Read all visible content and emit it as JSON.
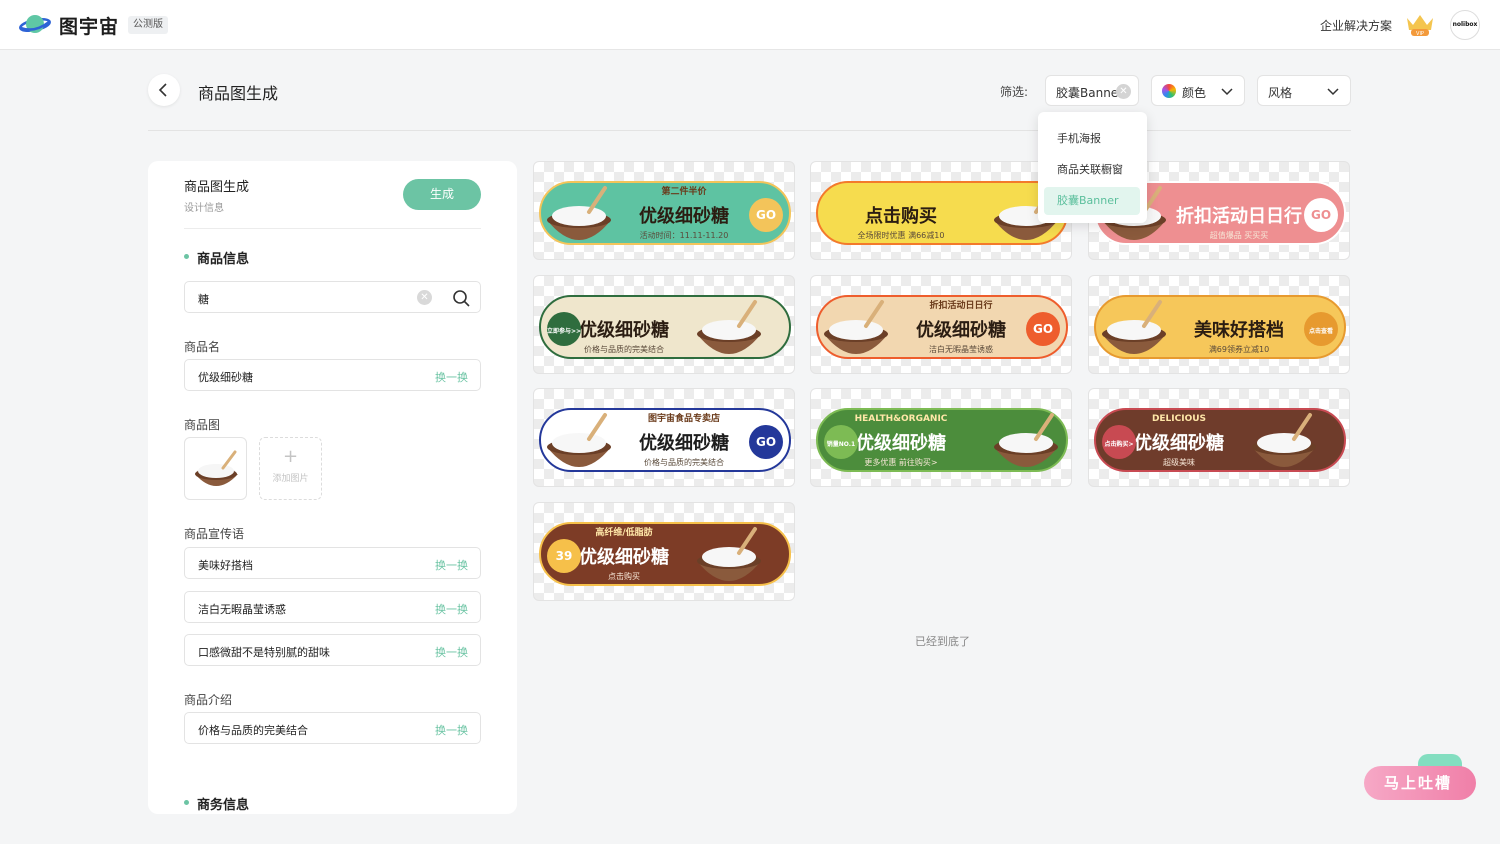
{
  "header": {
    "logo_text": "图宇宙",
    "beta_badge": "公测版",
    "enterprise_link": "企业解决方案",
    "vip_badge": "VIP",
    "avatar_text": "nolibox"
  },
  "page": {
    "title": "商品图生成"
  },
  "filters": {
    "label": "筛选:",
    "type_value": "胶囊Banner",
    "color_label": "颜色",
    "style_label": "风格",
    "dropdown_options": [
      "手机海报",
      "商品关联橱窗",
      "胶囊Banner"
    ],
    "dropdown_selected": "胶囊Banner"
  },
  "panel": {
    "title": "商品图生成",
    "subtitle": "设计信息",
    "generate_button": "生成",
    "product_info_title": "商品信息",
    "search_value": "糖",
    "product_name_label": "商品名",
    "product_name_value": "优级细砂糖",
    "product_image_label": "商品图",
    "add_image_label": "添加图片",
    "slogan_label": "商品宣传语",
    "slogans": [
      "美味好搭档",
      "洁白无暇晶莹诱惑",
      "口感微甜不是特别腻的甜味"
    ],
    "intro_label": "商品介绍",
    "intro_value": "价格与品质的完美结合",
    "swap_label": "换一换",
    "business_info_title": "商务信息"
  },
  "banners": [
    {
      "top": "第二件半价",
      "title": "优级细砂糖",
      "sub": "活动时间：11.11-11.20",
      "cta": "GO",
      "bg": "#5ec3a2",
      "accent": "#f3c45a"
    },
    {
      "top": "",
      "title": "点击购买",
      "sub": "全场限时优惠 满66减10",
      "cta": "",
      "bg": "#f6dc4e",
      "accent": "#f37a2b"
    },
    {
      "top": "",
      "title": "折扣活动日日行",
      "sub": "超值爆品 买买买",
      "cta": "GO",
      "bg": "#ee8f91",
      "accent": "#ffffff"
    },
    {
      "top": "",
      "title": "优级细砂糖",
      "sub": "价格与品质的完美结合",
      "cta": "立即参与>>",
      "bg": "#efe6cc",
      "accent": "#2f6d3e"
    },
    {
      "top": "折扣活动日日行",
      "title": "优级细砂糖",
      "sub": "洁白无暇晶莹诱惑",
      "cta": "GO",
      "bg": "#f2d7b0",
      "accent": "#ee5d2d"
    },
    {
      "top": "",
      "title": "美味好搭档",
      "sub": "满69领券立减10",
      "cta": "点击查看",
      "bg": "#f6c75a",
      "accent": "#e79a2f"
    },
    {
      "top": "图宇宙食品专卖店",
      "title": "优级细砂糖",
      "sub": "价格与品质的完美结合",
      "cta": "GO",
      "bg": "#ffffff",
      "accent": "#24389a"
    },
    {
      "top": "HEALTH&ORGANIC",
      "title": "优级细砂糖",
      "sub": "更多优惠 前往购买>",
      "cta": "销量NO.1",
      "bg": "#4c8d3c",
      "accent": "#7dbb54"
    },
    {
      "top": "DELICIOUS",
      "title": "优级细砂糖",
      "sub": "超级美味",
      "cta": "点击购买>",
      "bg": "#6f3c2b",
      "accent": "#c84a52"
    },
    {
      "top": "高纤维/低脂肪",
      "title": "优级细砂糖",
      "sub": "点击购买",
      "cta": "39",
      "bg": "#7d3c26",
      "accent": "#f6c04a"
    }
  ],
  "end_text": "已经到底了",
  "feedback_button": "马上吐槽"
}
